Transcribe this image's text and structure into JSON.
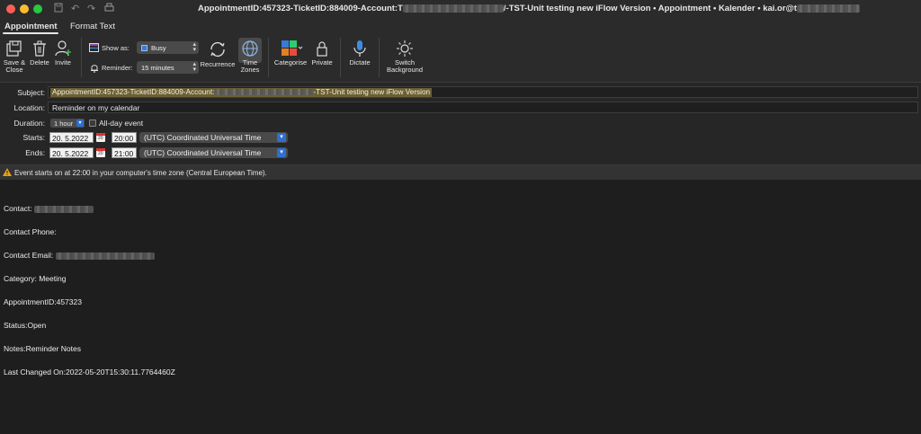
{
  "window": {
    "title_prefix": "AppointmentID:457323-TicketID:884009-Account:T",
    "title_suffix": "/-TST-Unit testing new iFlow Version • Appointment • Kalender • kai.or@t"
  },
  "tabs": [
    {
      "label": "Appointment"
    },
    {
      "label": "Format Text"
    }
  ],
  "ribbon": {
    "save_close": [
      "Save &",
      "Close"
    ],
    "delete": "Delete",
    "invite": "Invite",
    "show_as_label": "Show as:",
    "show_as_value": "Busy",
    "reminder_label": "Reminder:",
    "reminder_value": "15 minutes",
    "recurrence": "Recurrence",
    "time_zones": [
      "Time",
      "Zones"
    ],
    "categorise": "Categorise",
    "private": "Private",
    "dictate": "Dictate",
    "switch_background": [
      "Switch",
      "Background"
    ]
  },
  "form": {
    "subject_label": "Subject:",
    "subject_prefix": "AppointmentID:457323-TicketID:884009-Account:",
    "subject_suffix": "-TST-Unit testing new iFlow Version",
    "location_label": "Location:",
    "location_value": "Reminder on my calendar",
    "duration_label": "Duration:",
    "duration_value": "1 hour",
    "allday_label": "All-day event",
    "starts_label": "Starts:",
    "starts_date": "20.  5.2022",
    "starts_time": "20:00",
    "starts_tz": "(UTC) Coordinated Universal Time",
    "ends_label": "Ends:",
    "ends_date": "20.  5.2022",
    "ends_time": "21:00",
    "ends_tz": "(UTC) Coordinated Universal Time",
    "calendar_day": "20",
    "info": "Event starts on  at 22:00 in your computer's time zone (Central European Time)."
  },
  "body": {
    "contact": "Contact:",
    "contact_phone": "Contact Phone:",
    "contact_email": "Contact Email:",
    "category": "Category: Meeting",
    "appointment_id": "AppointmentID:457323",
    "status": "Status:Open",
    "notes": "Notes:Reminder Notes",
    "last_changed": "Last Changed On:2022-05-20T15:30:11.7764460Z"
  },
  "colors": {
    "background": "#1e1e1e",
    "ribbon": "#2b2b2b",
    "accent_blue": "#2f6fd1",
    "subject_highlight": "#6b5f33"
  }
}
